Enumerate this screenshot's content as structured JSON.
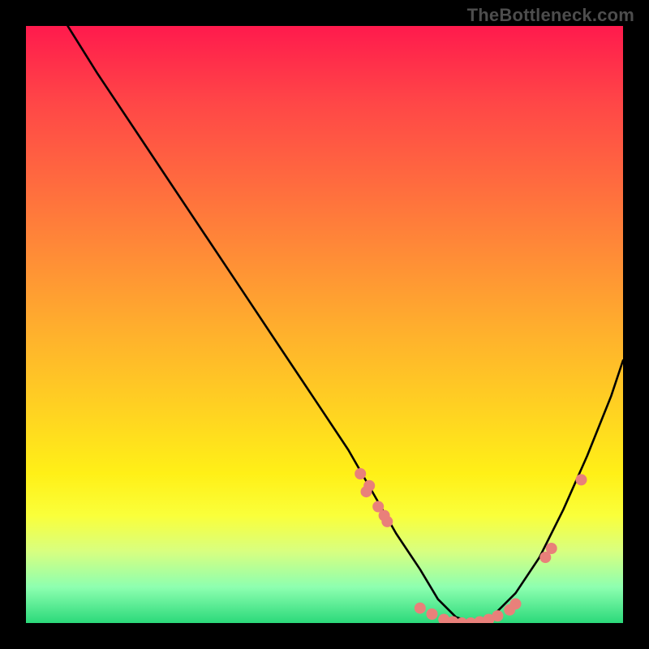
{
  "watermark": "TheBottleneck.com",
  "colors": {
    "background": "#000000",
    "curve": "#000000",
    "dots": "#e9807a"
  },
  "chart_data": {
    "type": "line",
    "title": "",
    "xlabel": "",
    "ylabel": "",
    "xlim": [
      0,
      100
    ],
    "ylim": [
      0,
      100
    ],
    "grid": false,
    "legend": false,
    "notes": "Axes, ticks, and units are not visible in the image. x/y are normalized 0–100 (left→right, bottom→top). Curve is a V-shape with minimum near x≈74; background is a vertical heat gradient from red (top) to green (bottom).",
    "series": [
      {
        "name": "curve",
        "x": [
          7,
          12,
          18,
          24,
          30,
          36,
          42,
          48,
          54,
          58,
          62,
          66,
          69,
          72,
          75,
          78,
          82,
          86,
          90,
          94,
          98,
          100
        ],
        "y": [
          100,
          92,
          83,
          74,
          65,
          56,
          47,
          38,
          29,
          22,
          15,
          9,
          4,
          1,
          0,
          1,
          5,
          11,
          19,
          28,
          38,
          44
        ]
      }
    ],
    "points": {
      "name": "markers",
      "x": [
        56,
        57.5,
        57,
        59,
        60,
        60.5,
        66,
        68,
        70,
        71.5,
        73,
        74.5,
        76,
        77.5,
        79,
        81,
        82,
        87,
        88,
        93
      ],
      "y": [
        25,
        23,
        22,
        19.5,
        18,
        17,
        2.5,
        1.5,
        0.6,
        0.2,
        0,
        0,
        0.2,
        0.6,
        1.2,
        2.2,
        3.2,
        11,
        12.5,
        24
      ]
    }
  }
}
